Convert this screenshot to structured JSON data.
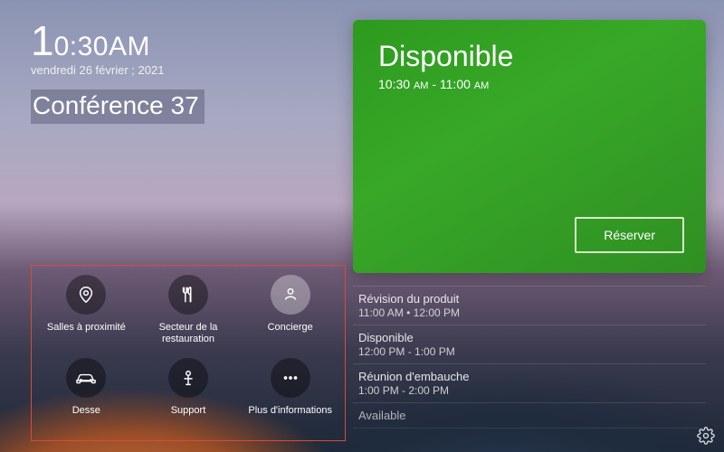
{
  "time": {
    "hour": "1",
    "rest": "0:30",
    "ampm": "AM"
  },
  "date": "vendredi 26 février ; 2021",
  "room_name": "Conférence 37",
  "status": {
    "title": "Disponible",
    "range_start": "10:30",
    "range_start_ampm": "AM",
    "range_sep": " - ",
    "range_end": "11:00",
    "range_end_ampm": "AM",
    "reserve_label": "Réserver"
  },
  "agenda": [
    {
      "title": "Révision du produit",
      "time": "11:00 AM • 12:00 PM"
    },
    {
      "title": "Disponible",
      "time": "12:00 PM - 1:00 PM"
    },
    {
      "title": "Réunion d'embauche",
      "time": "1:00 PM - 2:00 PM"
    },
    {
      "title": "Available",
      "time": ""
    }
  ],
  "quick_actions": [
    {
      "id": "nearby-rooms",
      "label": "Salles à proximité",
      "icon": "pin-icon"
    },
    {
      "id": "dining",
      "label": "Secteur de la restauration",
      "icon": "utensils-icon"
    },
    {
      "id": "concierge",
      "label": "Concierge",
      "icon": "concierge-icon",
      "selected": true
    },
    {
      "id": "car",
      "label": "Desse",
      "icon": "car-icon"
    },
    {
      "id": "support",
      "label": "Support",
      "icon": "support-icon"
    },
    {
      "id": "more",
      "label": "Plus d'informations",
      "icon": "more-icon"
    }
  ]
}
